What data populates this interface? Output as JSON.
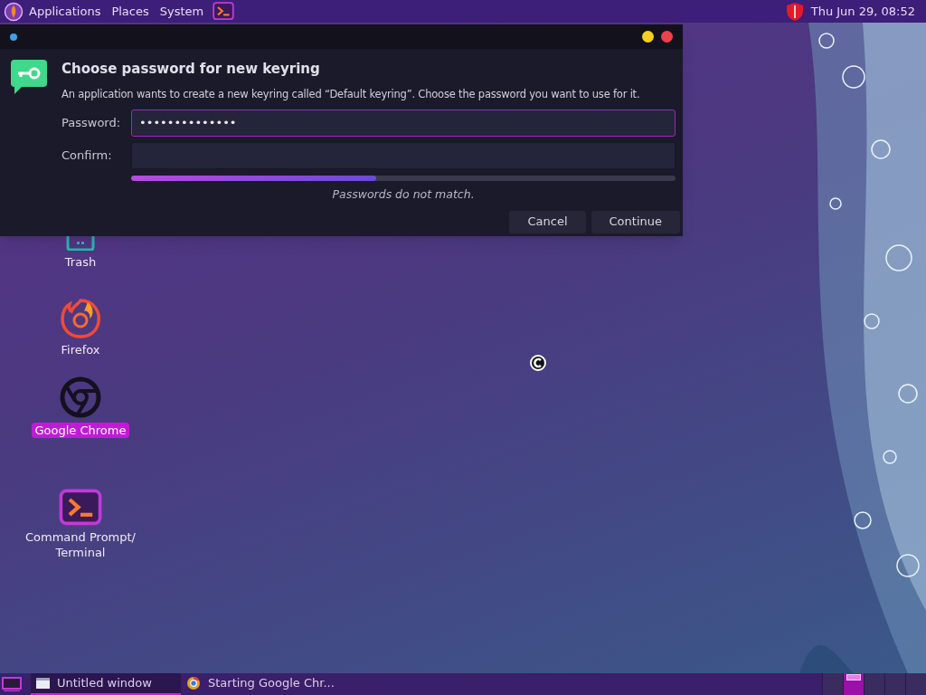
{
  "top_panel": {
    "menus": [
      {
        "label": "Applications"
      },
      {
        "label": "Places"
      },
      {
        "label": "System"
      }
    ],
    "clock": "Thu Jun 29, 08:52"
  },
  "dialog": {
    "title": "Choose password for new keyring",
    "message": "An application wants to create a new keyring called “Default keyring”. Choose the password you want to use for it.",
    "fields": [
      {
        "label": "Password:",
        "value": "••••••••••••••",
        "focused": true
      },
      {
        "label": "Confirm:",
        "focused": false
      }
    ],
    "strength": {
      "level": 0.45
    },
    "error": "Passwords do not match.",
    "buttons": [
      "Cancel",
      "Continue"
    ]
  },
  "desktop_icons": [
    {
      "kind": "trash",
      "label": "Trash",
      "selected": false
    },
    {
      "kind": "firefox",
      "label": "Firefox",
      "selected": false
    },
    {
      "kind": "chrome",
      "label": "Google Chrome",
      "selected": true
    },
    {
      "kind": "terminal",
      "label": "Command Prompt/ Terminal",
      "selected": false
    }
  ],
  "taskbar": {
    "tasks": [
      {
        "kind": "window",
        "label": "Untitled window",
        "selected": true
      },
      {
        "kind": "chrome",
        "label": "Starting Google Chr...",
        "selected": false
      }
    ],
    "workspaces": [
      {
        "selected": false
      },
      {
        "selected": true
      },
      {
        "selected": false
      },
      {
        "selected": false
      },
      {
        "selected": false
      }
    ]
  }
}
